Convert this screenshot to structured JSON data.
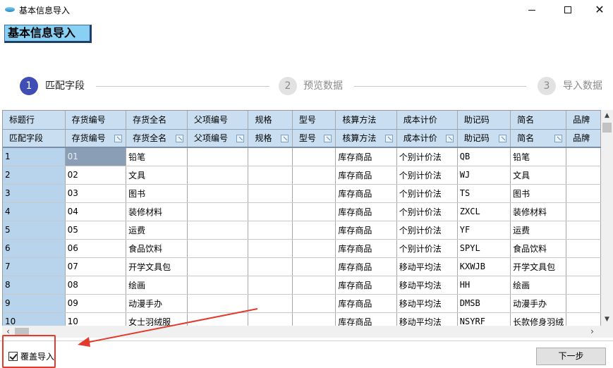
{
  "window": {
    "title": "基本信息导入"
  },
  "header": {
    "title": "基本信息导入"
  },
  "steps": [
    {
      "num": "1",
      "label": "匹配字段"
    },
    {
      "num": "2",
      "label": "预览数据"
    },
    {
      "num": "3",
      "label": "导入数据"
    }
  ],
  "grid": {
    "columns": [
      "标题行",
      "存货编号",
      "存货全名",
      "父项编号",
      "规格",
      "型号",
      "核算方法",
      "成本计价",
      "助记码",
      "简名",
      "品牌"
    ],
    "match_row": [
      "匹配字段",
      "存货编号",
      "存货全名",
      "父项编号",
      "规格",
      "型号",
      "核算方法",
      "成本计价",
      "助记码",
      "简名",
      "品牌"
    ],
    "rows": [
      [
        "1",
        "01",
        "铅笔",
        "",
        "",
        "",
        "库存商品",
        "个别计价法",
        "QB",
        "铅笔",
        ""
      ],
      [
        "2",
        "02",
        "文具",
        "",
        "",
        "",
        "库存商品",
        "个别计价法",
        "WJ",
        "文具",
        ""
      ],
      [
        "3",
        "03",
        "图书",
        "",
        "",
        "",
        "库存商品",
        "个别计价法",
        "TS",
        "图书",
        ""
      ],
      [
        "4",
        "04",
        "装修材料",
        "",
        "",
        "",
        "库存商品",
        "个别计价法",
        "ZXCL",
        "装修材料",
        ""
      ],
      [
        "5",
        "05",
        "运费",
        "",
        "",
        "",
        "库存商品",
        "个别计价法",
        "YF",
        "运费",
        ""
      ],
      [
        "6",
        "06",
        "食品饮料",
        "",
        "",
        "",
        "库存商品",
        "个别计价法",
        "SPYL",
        "食品饮料",
        ""
      ],
      [
        "7",
        "07",
        "开学文具包",
        "",
        "",
        "",
        "库存商品",
        "移动平均法",
        "KXWJB",
        "开学文具包",
        ""
      ],
      [
        "8",
        "08",
        "绘画",
        "",
        "",
        "",
        "库存商品",
        "移动平均法",
        "HH",
        "绘画",
        ""
      ],
      [
        "9",
        "09",
        "动漫手办",
        "",
        "",
        "",
        "库存商品",
        "移动平均法",
        "DMSB",
        "动漫手办",
        ""
      ],
      [
        "10",
        "10",
        "女士羽绒服",
        "",
        "",
        "",
        "库存商品",
        "移动平均法",
        "NSYRF",
        "长款修身羽绒",
        ""
      ]
    ]
  },
  "footer": {
    "cover_import_label": "覆盖导入",
    "cover_import_checked": true,
    "next_label": "下一步"
  },
  "colors": {
    "accent": "#3f4db5",
    "header_bg": "#88d1f5",
    "grid_header_bg": "#c9def0",
    "annotation_red": "#e23b2e"
  },
  "icons": {
    "app": "app-logo-icon",
    "minimize": "minimize-icon",
    "maximize": "maximize-icon",
    "close": "close-icon",
    "field_pick": "field-pick-icon"
  }
}
